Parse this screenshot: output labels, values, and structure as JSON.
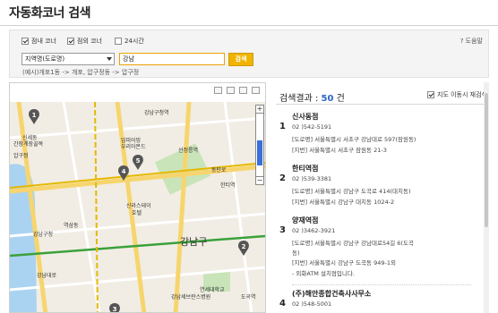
{
  "page": {
    "title": "자동화코너 검색"
  },
  "filters": {
    "checkboxes": [
      {
        "label": "점내 코너",
        "checked": true
      },
      {
        "label": "점외 코너",
        "checked": true
      },
      {
        "label": "24시간",
        "checked": false
      }
    ],
    "help_label": "? 도움말",
    "select_value": "지역명(도로명)",
    "input_value": "강남",
    "search_button": "검색",
    "example": "(예시)개포1동 -> 개포, 압구정동 -> 압구정"
  },
  "map": {
    "colors": {
      "background": "#f1ede4",
      "water": "#aad3f1",
      "park": "#c9e4b9",
      "road_major": "#f7d56e",
      "road": "#ffffff",
      "line_green": "#3aa13a",
      "line_yellow": "#e6b800",
      "marker": "#555555"
    },
    "labels": [
      "강남구청역",
      "신세동",
      "간장계장골목",
      "압구정",
      "임피어밍",
      "우리아몬드",
      "선정릉역",
      "동탄로",
      "한티역",
      "강남구",
      "신라스테이",
      "호텔",
      "역삼동",
      "연세대학교",
      "강남세브란스병원",
      "도곡역",
      "강남구청",
      "강남대로"
    ],
    "markers": [
      "1",
      "2",
      "3",
      "4",
      "5"
    ],
    "zoom_plus": "+",
    "zoom_minus": "−"
  },
  "results": {
    "head_label": "검색결과 : ",
    "count": "50",
    "unit": " 건",
    "map_move_label": "지도 이동시 재검색",
    "map_move_checked": true,
    "items": [
      {
        "num": "1",
        "name": "신사동점",
        "phone": "02 )542-5191",
        "road": "[도로명] 서울특별시 서초구 강남대로 597(잠원동)",
        "lot": "[지번] 서울특별시 서초구 잠원동 21-3"
      },
      {
        "num": "2",
        "name": "한티역점",
        "phone": "02 )539-3381",
        "road": "[도로명] 서울특별시 강남구 도곡로 414(대치동)",
        "lot": "[지번] 서울특별시 강남구 대치동 1024-2"
      },
      {
        "num": "3",
        "name": "양재역점",
        "phone": "02 )3462-3921",
        "road1": "[도로명] 서울특별시 강남구 강남대로54길 6(도곡",
        "road2": "동)",
        "lot": "[지번] 서울특별시 강남구 도곡동 949-1외",
        "note": "- 외화ATM 설치점입니다."
      },
      {
        "num": "4",
        "name": "(주)해안종합건축사사무소",
        "phone": "02 )548-5001"
      }
    ]
  }
}
